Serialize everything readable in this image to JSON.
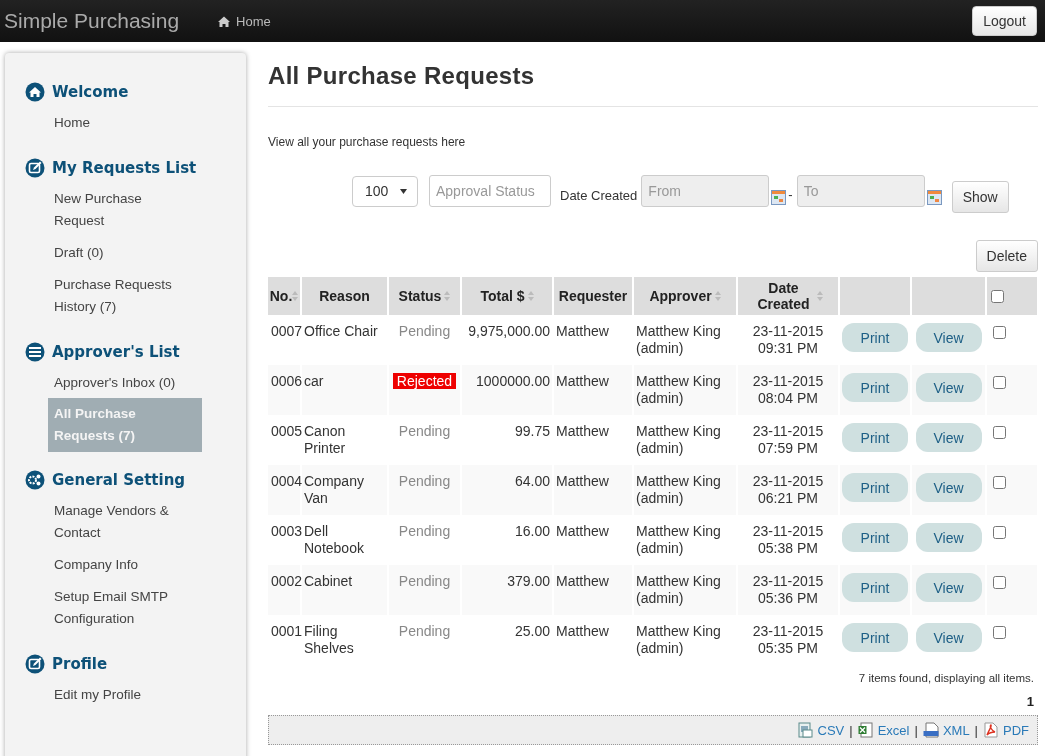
{
  "navbar": {
    "brand": "Simple Purchasing",
    "links": [
      {
        "label": "Home",
        "kind": "home"
      }
    ],
    "logout": "Logout"
  },
  "sidebar": {
    "sections": [
      {
        "title": "Welcome",
        "kind": "home",
        "items": [
          {
            "label": "Home",
            "selected": false
          }
        ]
      },
      {
        "title": "My Requests List",
        "kind": "edit",
        "items": [
          {
            "label": "New Purchase Request",
            "selected": false
          },
          {
            "label": "Draft (0)",
            "selected": false
          },
          {
            "label": "Purchase Requests History (7)",
            "selected": false
          }
        ]
      },
      {
        "title": "Approver's List",
        "kind": "list",
        "items": [
          {
            "label": "Approver's Inbox (0)",
            "selected": false
          },
          {
            "label": "All Purchase Requests (7)",
            "selected": true
          }
        ]
      },
      {
        "title": "General Setting",
        "kind": "gear",
        "items": [
          {
            "label": "Manage Vendors & Contact",
            "selected": false
          },
          {
            "label": "Company Info",
            "selected": false
          },
          {
            "label": "Setup Email SMTP Configuration",
            "selected": false
          }
        ]
      },
      {
        "title": "Profile",
        "kind": "edit",
        "items": [
          {
            "label": "Edit my Profile",
            "selected": false
          }
        ]
      }
    ]
  },
  "page": {
    "title": "All Purchase Requests",
    "description": "View all your purchase requests here"
  },
  "filters": {
    "page_size": "100",
    "approval_status": {
      "placeholder": "Approval Status"
    },
    "date_label": "Date Created",
    "from": {
      "placeholder": "From"
    },
    "range_separator": "-",
    "to": {
      "placeholder": "To"
    },
    "show_button": "Show"
  },
  "delete_button": "Delete",
  "table": {
    "columns": [
      {
        "label": "No.",
        "sortable": true
      },
      {
        "label": "Reason",
        "sortable": false
      },
      {
        "label": "Status",
        "sortable": true
      },
      {
        "label": "Total $",
        "sortable": true
      },
      {
        "label": "Requester",
        "sortable": false
      },
      {
        "label": "Approver",
        "sortable": true
      },
      {
        "label": "Date Created",
        "sortable": true
      },
      {
        "sortable": false
      },
      {
        "sortable": false
      },
      {
        "kind": "checkbox",
        "checked": false
      }
    ],
    "rows": [
      {
        "no": "0007",
        "reason": "Office Chair",
        "status": "Pending",
        "kind": "pending",
        "total": "9,975,000.00",
        "requester": "Matthew",
        "approver": "Matthew King (admin)",
        "date": "23-11-2015",
        "time": "09:31 PM",
        "print": "Print",
        "view": "View",
        "checked": false
      },
      {
        "no": "0006",
        "reason": "car",
        "status": "Rejected",
        "kind": "rejected",
        "total": "1000000.00",
        "requester": "Matthew",
        "approver": "Matthew King (admin)",
        "date": "23-11-2015",
        "time": "08:04 PM",
        "print": "Print",
        "view": "View",
        "checked": false
      },
      {
        "no": "0005",
        "reason": "Canon Printer",
        "status": "Pending",
        "kind": "pending",
        "total": "99.75",
        "requester": "Matthew",
        "approver": "Matthew King (admin)",
        "date": "23-11-2015",
        "time": "07:59 PM",
        "print": "Print",
        "view": "View",
        "checked": false
      },
      {
        "no": "0004",
        "reason": "Company Van",
        "status": "Pending",
        "kind": "pending",
        "total": "64.00",
        "requester": "Matthew",
        "approver": "Matthew King (admin)",
        "date": "23-11-2015",
        "time": "06:21 PM",
        "print": "Print",
        "view": "View",
        "checked": false
      },
      {
        "no": "0003",
        "reason": "Dell Notebook",
        "status": "Pending",
        "kind": "pending",
        "total": "16.00",
        "requester": "Matthew",
        "approver": "Matthew King (admin)",
        "date": "23-11-2015",
        "time": "05:38 PM",
        "print": "Print",
        "view": "View",
        "checked": false
      },
      {
        "no": "0002",
        "reason": "Cabinet",
        "status": "Pending",
        "kind": "pending",
        "total": "379.00",
        "requester": "Matthew",
        "approver": "Matthew King (admin)",
        "date": "23-11-2015",
        "time": "05:36 PM",
        "print": "Print",
        "view": "View",
        "checked": false
      },
      {
        "no": "0001",
        "reason": "Filing Shelves",
        "status": "Pending",
        "kind": "pending",
        "total": "25.00",
        "requester": "Matthew",
        "approver": "Matthew King (admin)",
        "date": "23-11-2015",
        "time": "05:35 PM",
        "print": "Print",
        "view": "View",
        "checked": false
      }
    ]
  },
  "summary": "7 items found, displaying all items.",
  "pages": [
    "1"
  ],
  "export": [
    {
      "kind": "csv",
      "label": "CSV"
    },
    {
      "kind": "excel",
      "label": "Excel",
      "separator_before": "|"
    },
    {
      "kind": "xml",
      "label": "XML",
      "separator_before": "|"
    },
    {
      "kind": "pdf",
      "label": "PDF",
      "separator_before": "|"
    }
  ]
}
